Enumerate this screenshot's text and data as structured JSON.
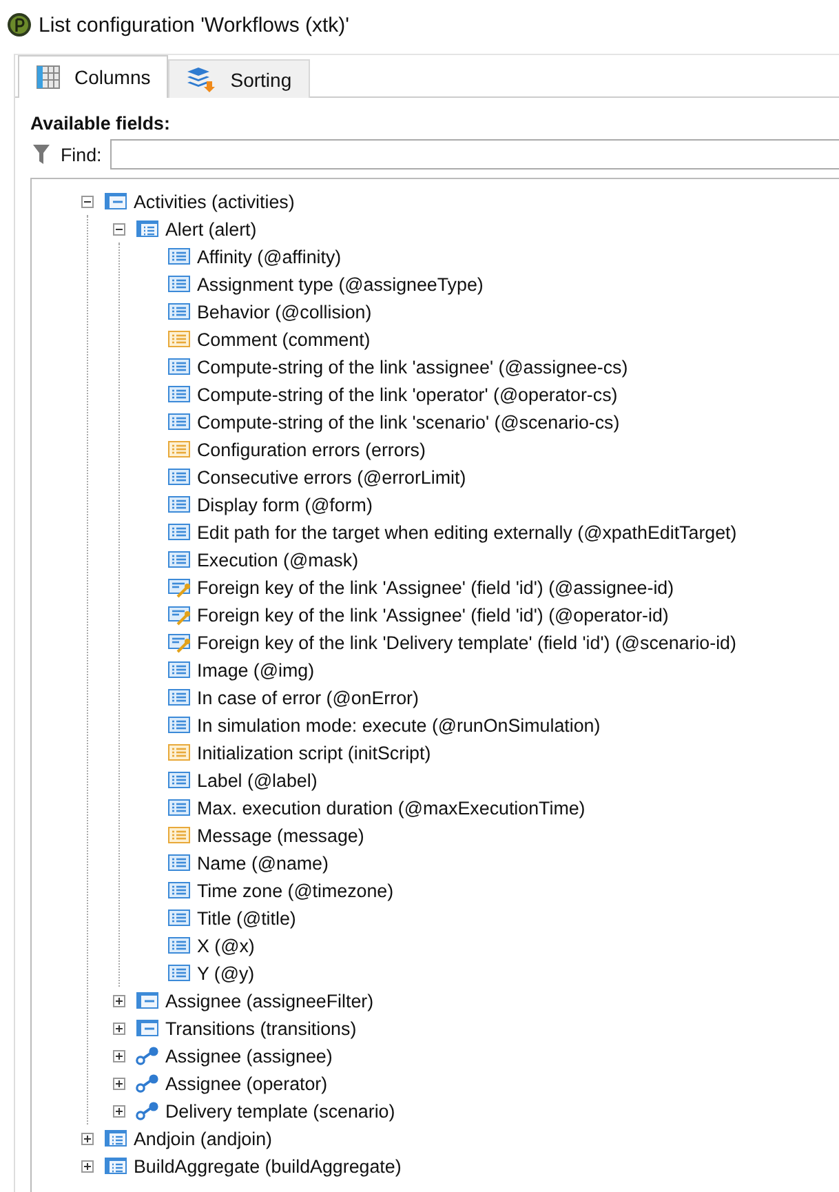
{
  "window": {
    "title": "List configuration 'Workflows (xtk)'"
  },
  "tabs": [
    {
      "label": "Columns",
      "kind": "columns",
      "selected": true
    },
    {
      "label": "Sorting",
      "kind": "sorting",
      "selected": false
    }
  ],
  "available_fields": {
    "label": "Available fields:",
    "find_label": "Find:"
  },
  "tree": [
    {
      "label": "Activities (activities)",
      "kind": "element",
      "expanded": true,
      "children": [
        {
          "label": "Alert (alert)",
          "kind": "list",
          "expanded": true,
          "children": [
            {
              "label": "Affinity (@affinity)",
              "kind": "attribute"
            },
            {
              "label": "Assignment type (@assigneeType)",
              "kind": "attribute"
            },
            {
              "label": "Behavior (@collision)",
              "kind": "attribute"
            },
            {
              "label": "Comment (comment)",
              "kind": "text"
            },
            {
              "label": "Compute-string of the link 'assignee' (@assignee-cs)",
              "kind": "attribute"
            },
            {
              "label": "Compute-string of the link 'operator' (@operator-cs)",
              "kind": "attribute"
            },
            {
              "label": "Compute-string of the link 'scenario' (@scenario-cs)",
              "kind": "attribute"
            },
            {
              "label": "Configuration errors (errors)",
              "kind": "text"
            },
            {
              "label": "Consecutive errors (@errorLimit)",
              "kind": "attribute"
            },
            {
              "label": "Display form (@form)",
              "kind": "attribute"
            },
            {
              "label": "Edit path for the target when editing externally (@xpathEditTarget)",
              "kind": "attribute"
            },
            {
              "label": "Execution (@mask)",
              "kind": "attribute"
            },
            {
              "label": "Foreign key of the link 'Assignee' (field 'id') (@assignee-id)",
              "kind": "key"
            },
            {
              "label": "Foreign key of the link 'Assignee' (field 'id') (@operator-id)",
              "kind": "key"
            },
            {
              "label": "Foreign key of the link 'Delivery template' (field 'id') (@scenario-id)",
              "kind": "key"
            },
            {
              "label": "Image (@img)",
              "kind": "attribute"
            },
            {
              "label": "In case of error (@onError)",
              "kind": "attribute"
            },
            {
              "label": "In simulation mode: execute (@runOnSimulation)",
              "kind": "attribute"
            },
            {
              "label": "Initialization script (initScript)",
              "kind": "text"
            },
            {
              "label": "Label (@label)",
              "kind": "attribute"
            },
            {
              "label": "Max. execution duration (@maxExecutionTime)",
              "kind": "attribute"
            },
            {
              "label": "Message (message)",
              "kind": "text"
            },
            {
              "label": "Name (@name)",
              "kind": "attribute"
            },
            {
              "label": "Time zone (@timezone)",
              "kind": "attribute"
            },
            {
              "label": "Title (@title)",
              "kind": "attribute"
            },
            {
              "label": "X (@x)",
              "kind": "attribute"
            },
            {
              "label": "Y (@y)",
              "kind": "attribute"
            }
          ]
        },
        {
          "label": "Assignee (assigneeFilter)",
          "kind": "element",
          "expanded": false
        },
        {
          "label": "Transitions (transitions)",
          "kind": "element",
          "expanded": false
        },
        {
          "label": "Assignee (assignee)",
          "kind": "link",
          "expanded": false
        },
        {
          "label": "Assignee (operator)",
          "kind": "link",
          "expanded": false
        },
        {
          "label": "Delivery template (scenario)",
          "kind": "link",
          "expanded": false
        }
      ]
    },
    {
      "label": "Andjoin (andjoin)",
      "kind": "list",
      "expanded": false
    },
    {
      "label": "BuildAggregate (buildAggregate)",
      "kind": "list",
      "expanded": false
    }
  ]
}
